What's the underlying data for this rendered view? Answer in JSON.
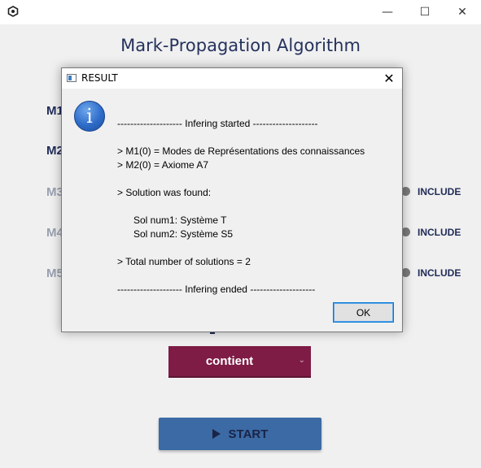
{
  "window": {
    "title": "Mark-Propagation Algorithm",
    "controls": {
      "minimize": "—",
      "maximize": "☐",
      "close": "✕"
    }
  },
  "rows": [
    {
      "label": "M1",
      "color": "#1f2b57"
    },
    {
      "label": "M2",
      "color": "#1f2b57"
    },
    {
      "label": "M3",
      "color": "#9aa0b0",
      "include": "INCLUDE"
    },
    {
      "label": "M4",
      "color": "#9aa0b0",
      "include": "INCLUDE"
    },
    {
      "label": "M5",
      "color": "#9aa0b0",
      "include": "INCLUDE"
    }
  ],
  "dropdown": {
    "value": "contient",
    "chevron": "⌄"
  },
  "start_button": {
    "label": "START"
  },
  "dialog": {
    "title": "RESULT",
    "close": "✕",
    "info_glyph": "i",
    "lines": [
      "-------------------- Infering started --------------------",
      "> M1(0) = Modes de Représentations des connaissances",
      "> M2(0) = Axiome A7",
      "> Solution was found:",
      "      Sol num1: Système T",
      "      Sol num2: Système S5",
      "> Total number of solutions = 2",
      "-------------------- Infering ended --------------------"
    ],
    "ok_label": "OK"
  },
  "colors": {
    "accent": "#7e1c45",
    "primary": "#3b6aa5",
    "title": "#25325c"
  }
}
